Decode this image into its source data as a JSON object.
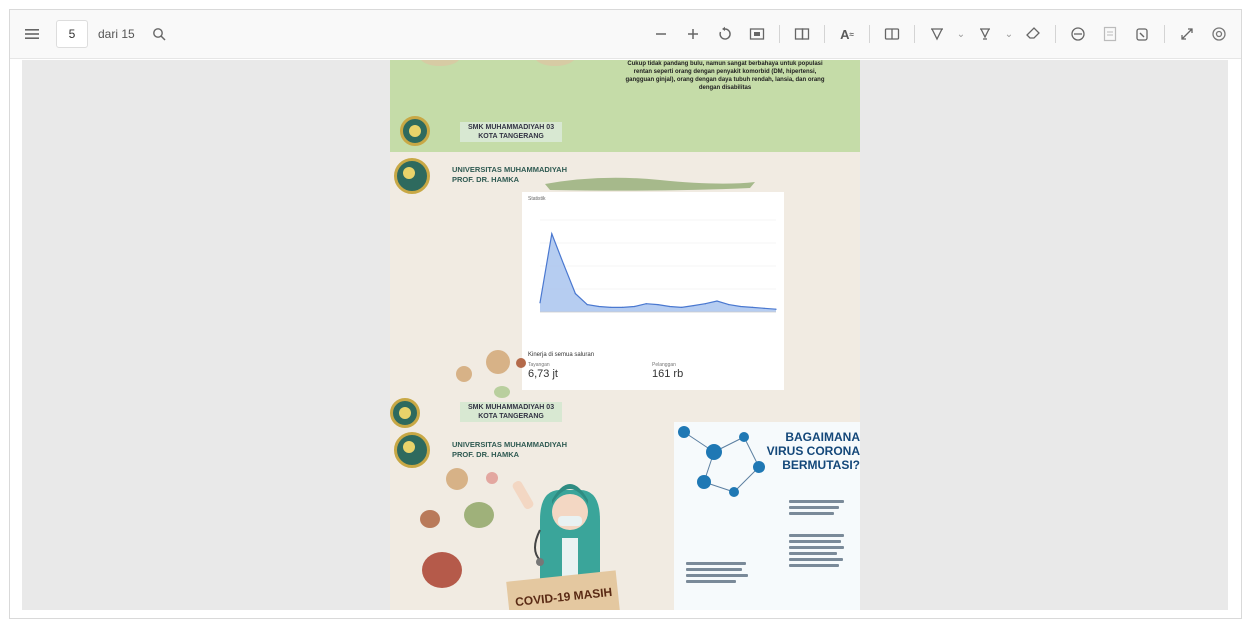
{
  "toolbar": {
    "menu_icon": "menu-icon",
    "page_current": "5",
    "page_total_text": "dari 15",
    "search_icon": "search-icon",
    "icons": [
      "zoom-out-icon",
      "zoom-in-icon",
      "rotate-icon",
      "fit-page-icon",
      "page-layout-icon",
      "text-size-icon",
      "two-page-icon",
      "draw-icon",
      "highlight-icon",
      "erase-icon",
      "print-icon",
      "save-icon",
      "copy-icon",
      "fullscreen-icon",
      "settings-icon"
    ]
  },
  "document": {
    "top_text": "Cukup tidak pandang bulu, namun sangat berbahaya untuk populasi rentan seperti orang dengan penyakit komorbid (DM, hipertensi, gangguan ginjal), orang dengan daya tubuh rendah, lansia, dan orang dengan disabilitas",
    "school_name_1": "SMK MUHAMMADIYAH 03",
    "school_city_1": "KOTA TANGERANG",
    "university_line1": "UNIVERSITAS MUHAMMADIYAH",
    "university_line2": "PROF. DR. HAMKA",
    "screenshot_title": "Statistik",
    "stat_label_1": "Tayangan",
    "stat_value_1": "6,73 jt",
    "stat_label_2": "Pelanggan",
    "stat_value_2": "161 rb",
    "screenshot_caption": "Kinerja di semua saluran",
    "school_name_2": "SMK MUHAMMADIYAH 03",
    "school_city_2": "KOTA TANGERANG",
    "university_line1_b": "UNIVERSITAS MUHAMMADIYAH",
    "university_line2_b": "PROF. DR. HAMKA",
    "panel_title_1": "BAGAIMANA",
    "panel_title_2": "VIRUS CORONA",
    "panel_title_3": "BERMUTASI?",
    "covid_text": "COVID-19 MASIH"
  },
  "colors": {
    "toolbar_bg": "#f9f9f9",
    "viewer_bg": "#e9e9e9",
    "page_bg": "#f1ebe2",
    "green_band": "#c5dca8",
    "chart_fill": "#a9c4ee",
    "chart_line": "#4a78d0",
    "title_blue": "#14487a"
  },
  "chart_data": {
    "type": "area",
    "x": [
      0,
      1,
      2,
      3,
      4,
      5,
      6,
      7,
      8,
      9,
      10,
      11,
      12,
      13,
      14,
      15,
      16,
      17,
      18,
      19,
      20
    ],
    "values": [
      10,
      85,
      52,
      20,
      8,
      6,
      5,
      5,
      6,
      9,
      8,
      6,
      5,
      7,
      9,
      12,
      8,
      6,
      5,
      4,
      3
    ],
    "xlabel": "",
    "ylabel": ""
  }
}
